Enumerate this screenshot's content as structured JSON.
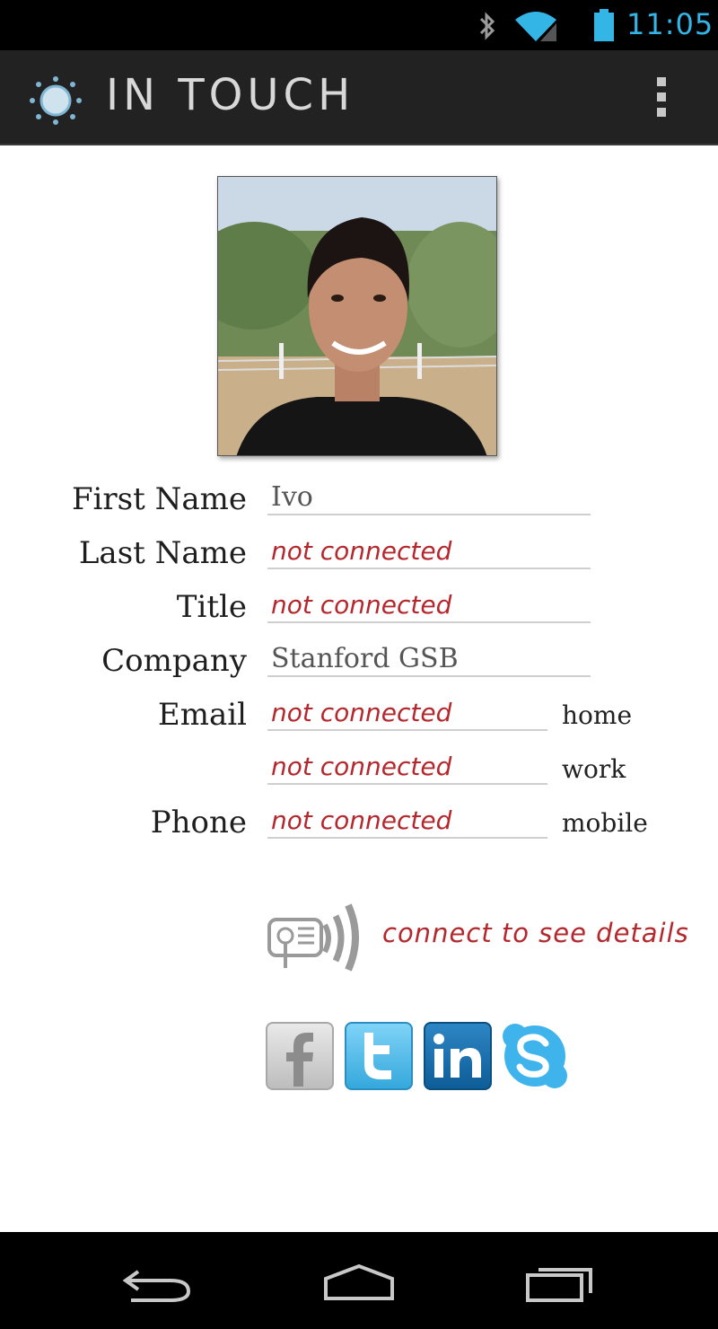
{
  "status_bar": {
    "time": "11:05",
    "icons": [
      "bluetooth-icon",
      "wifi-icon",
      "signal-icon",
      "battery-icon"
    ],
    "accent_color": "#33b5e5"
  },
  "action_bar": {
    "title": "IN TOUCH",
    "logo_icon": "sun-logo-icon",
    "overflow_icon": "overflow-menu-icon"
  },
  "profile": {
    "photo_icon": "profile-photo",
    "fields": {
      "first_name": {
        "label": "First Name",
        "value": "Ivo"
      },
      "last_name": {
        "label": "Last Name",
        "value": "not connected"
      },
      "title": {
        "label": "Title",
        "value": "not connected"
      },
      "company": {
        "label": "Company",
        "value": "Stanford GSB"
      },
      "email": {
        "label": "Email",
        "home": {
          "value": "not connected",
          "tag": "home"
        },
        "work": {
          "value": "not connected",
          "tag": "work"
        }
      },
      "phone": {
        "label": "Phone",
        "mobile": {
          "value": "not connected",
          "tag": "mobile"
        }
      }
    },
    "not_connected_color": "#b4282d"
  },
  "connect": {
    "icon": "nfc-connect-icon",
    "text": "connect to see details"
  },
  "social": [
    "facebook-icon",
    "twitter-icon",
    "linkedin-icon",
    "skype-icon"
  ],
  "nav_bar": [
    "back-icon",
    "home-icon",
    "recent-apps-icon"
  ]
}
